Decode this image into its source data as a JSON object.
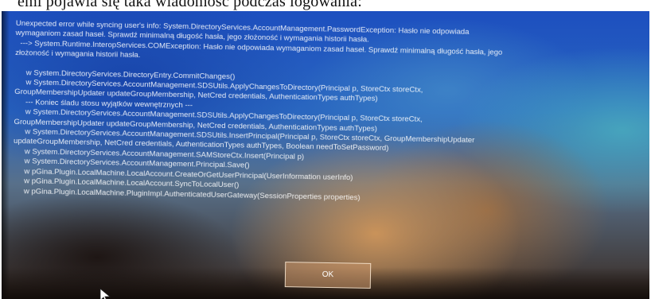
{
  "caption": {
    "text": "emi pojawia się taka wiadomość podczas logowania:"
  },
  "dialog": {
    "lines": [
      "Unexpected error while syncing user's info: System.DirectoryServices.AccountManagement.PasswordException: Hasło nie odpowiada",
      "wymaganiom zasad haseł. Sprawdź minimalną długość hasła, jego złożoność i wymagania historii hasła.",
      "---> System.Runtime.InteropServices.COMException: Hasło nie odpowiada wymaganiom zasad haseł. Sprawdź minimalną długość hasła, jego",
      "złożoność i wymagania historii hasła.",
      "",
      "w System.DirectoryServices.DirectoryEntry.CommitChanges()",
      "w System.DirectoryServices.AccountManagement.SDSUtils.ApplyChangesToDirectory(Principal p, StoreCtx storeCtx,",
      "GroupMembershipUpdater updateGroupMembership, NetCred credentials, AuthenticationTypes authTypes)",
      "--- Koniec śladu stosu wyjątków wewnętrznych ---",
      "w System.DirectoryServices.AccountManagement.SDSUtils.ApplyChangesToDirectory(Principal p, StoreCtx storeCtx,",
      "GroupMembershipUpdater updateGroupMembership, NetCred credentials, AuthenticationTypes authTypes)",
      "w System.DirectoryServices.AccountManagement.SDSUtils.InsertPrincipal(Principal p, StoreCtx storeCtx, GroupMembershipUpdater",
      "updateGroupMembership, NetCred credentials, AuthenticationTypes authTypes, Boolean needToSetPassword)",
      "w System.DirectoryServices.AccountManagement.SAMStoreCtx.Insert(Principal p)",
      "w System.DirectoryServices.AccountManagement.Principal.Save()",
      "w pGina.Plugin.LocalMachine.LocalAccount.CreateOrGetUserPrincipal(UserInformation userInfo)",
      "w pGina.Plugin.LocalMachine.LocalAccount.SyncToLocalUser()",
      "w pGina.Plugin.LocalMachine.PluginImpl.AuthenticatedUserGateway(SessionProperties properties)"
    ],
    "ok_label": "OK"
  }
}
